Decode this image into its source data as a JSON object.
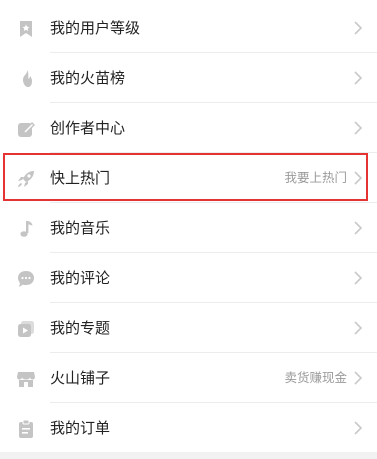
{
  "menu": {
    "items": [
      {
        "label": "我的用户等级",
        "hint": "",
        "icon": "bookmark-star-icon"
      },
      {
        "label": "我的火苗榜",
        "hint": "",
        "icon": "flame-icon"
      },
      {
        "label": "创作者中心",
        "hint": "",
        "icon": "edit-square-icon"
      },
      {
        "label": "快上热门",
        "hint": "我要上热门",
        "icon": "rocket-icon"
      },
      {
        "label": "我的音乐",
        "hint": "",
        "icon": "music-note-icon"
      },
      {
        "label": "我的评论",
        "hint": "",
        "icon": "comment-icon"
      },
      {
        "label": "我的专题",
        "hint": "",
        "icon": "topic-play-icon"
      },
      {
        "label": "火山铺子",
        "hint": "卖货赚现金",
        "icon": "shop-icon"
      },
      {
        "label": "我的订单",
        "hint": "",
        "icon": "clipboard-icon"
      }
    ]
  },
  "colors": {
    "text": "#222222",
    "hint": "#9a9a9a",
    "icon": "#c4c4c4",
    "chevron": "#c9c9c9",
    "highlight": "#e53333",
    "divider": "#ececec"
  }
}
